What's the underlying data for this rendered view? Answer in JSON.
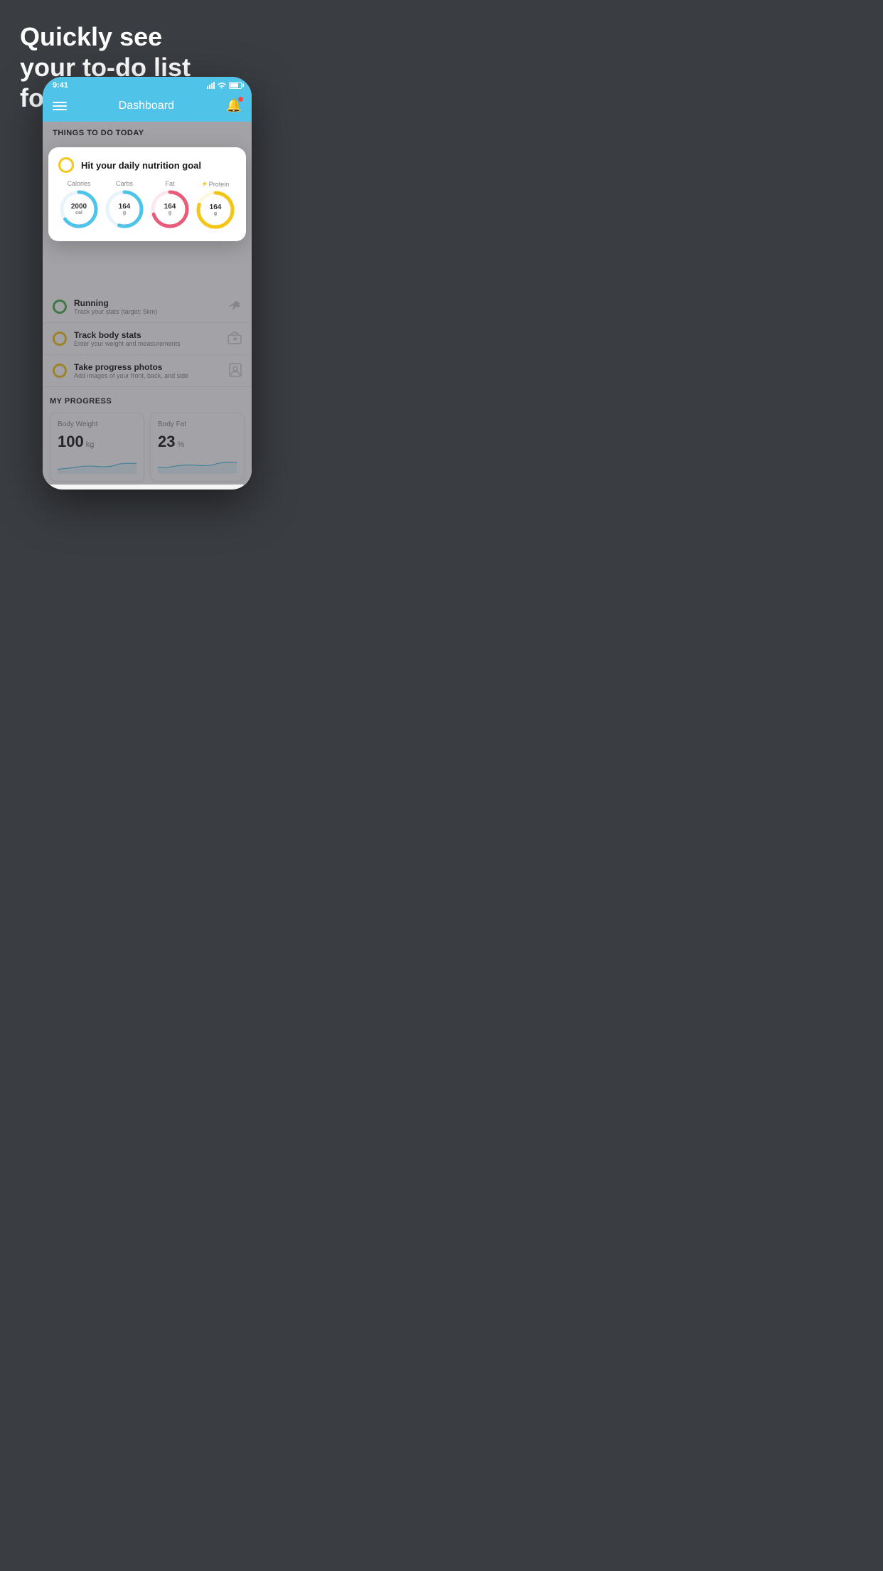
{
  "background": {
    "headline_line1": "Quickly see",
    "headline_line2": "your to-do list",
    "headline_line3": "for the day."
  },
  "status_bar": {
    "time": "9:41"
  },
  "header": {
    "title": "Dashboard"
  },
  "things_to_do": {
    "section_label": "THINGS TO DO TODAY",
    "floating_card": {
      "title": "Hit your daily nutrition goal",
      "nutrition": [
        {
          "label": "Calories",
          "value": "2000",
          "unit": "cal",
          "color": "#4fc3e8",
          "percent": 65
        },
        {
          "label": "Carbs",
          "value": "164",
          "unit": "g",
          "color": "#4fc3e8",
          "percent": 55
        },
        {
          "label": "Fat",
          "value": "164",
          "unit": "g",
          "color": "#e85c7a",
          "percent": 70
        },
        {
          "label": "Protein",
          "value": "164",
          "unit": "g",
          "color": "#f5c518",
          "percent": 80,
          "starred": true
        }
      ]
    },
    "todo_items": [
      {
        "id": "running",
        "title": "Running",
        "subtitle": "Track your stats (target: 5km)",
        "circle_color": "green",
        "icon": "👟"
      },
      {
        "id": "body-stats",
        "title": "Track body stats",
        "subtitle": "Enter your weight and measurements",
        "circle_color": "yellow",
        "icon": "⚖"
      },
      {
        "id": "progress-photos",
        "title": "Take progress photos",
        "subtitle": "Add images of your front, back, and side",
        "circle_color": "yellow",
        "icon": "👤"
      }
    ]
  },
  "my_progress": {
    "section_label": "MY PROGRESS",
    "cards": [
      {
        "id": "body-weight",
        "title": "Body Weight",
        "value": "100",
        "unit": "kg"
      },
      {
        "id": "body-fat",
        "title": "Body Fat",
        "value": "23",
        "unit": "%"
      }
    ]
  }
}
